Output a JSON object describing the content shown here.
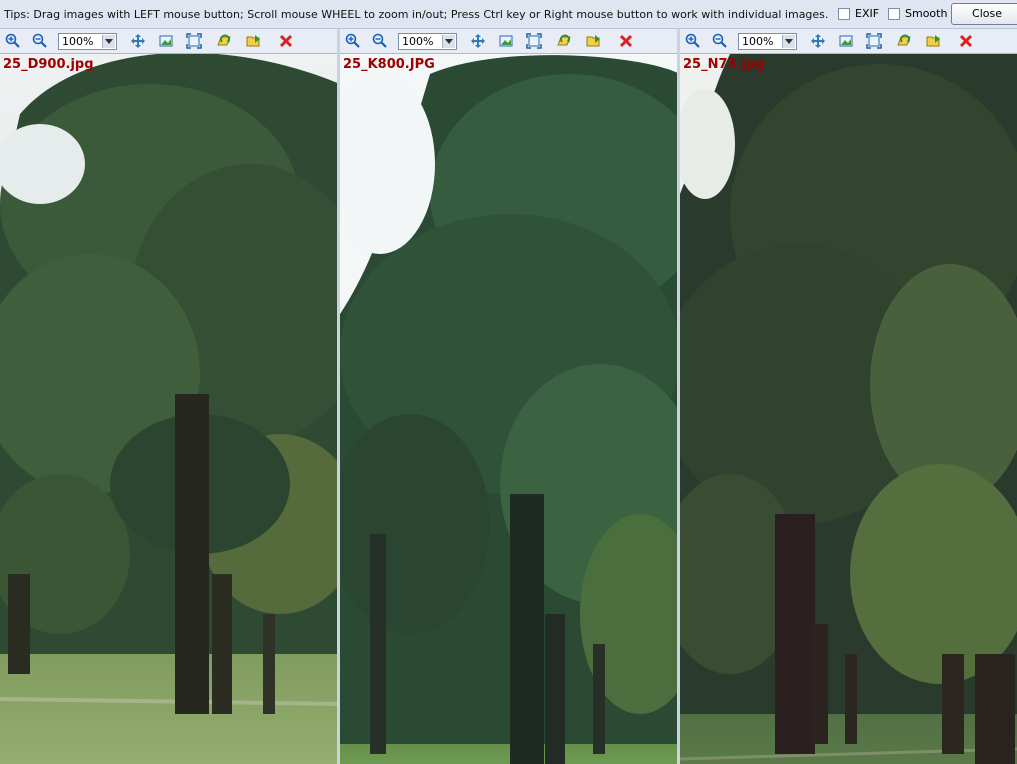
{
  "tips": "Tips: Drag images with LEFT mouse button; Scroll mouse WHEEL to zoom in/out; Press Ctrl key or Right mouse button to work with individual images.",
  "options": {
    "exif_label": "EXIF",
    "smooth_label": "Smooth",
    "close_label": "Close"
  },
  "panels": [
    {
      "filename": "25_D900.jpg",
      "zoom": "100%"
    },
    {
      "filename": "25_K800.JPG",
      "zoom": "100%"
    },
    {
      "filename": "25_N73.jpg",
      "zoom": "100%"
    }
  ]
}
